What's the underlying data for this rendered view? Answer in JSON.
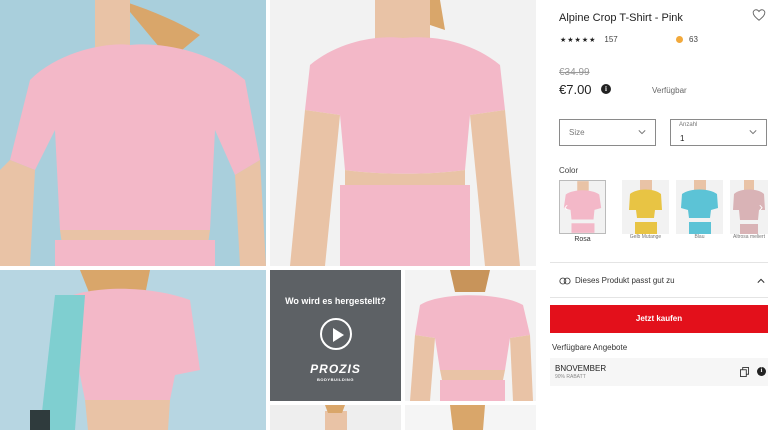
{
  "product": {
    "title": "Alpine Crop T-Shirt - Pink",
    "rating_count": "157",
    "rating_stars": 4.5,
    "points": "63",
    "old_price": "€34.99",
    "price": "€7.00",
    "availability": "Verfügbar"
  },
  "size_select": {
    "placeholder": "Size"
  },
  "quantity_select": {
    "label": "Anzahl",
    "value": "1"
  },
  "color": {
    "label": "Color",
    "options": [
      {
        "label": "Rosa",
        "hex": "#f3b8c8",
        "selected": true
      },
      {
        "label": "Gelb Mutange",
        "hex": "#e8c444"
      },
      {
        "label": "Blau",
        "hex": "#5cc3d6"
      },
      {
        "label": "Altrosa meliert",
        "hex": "#d9b3b6"
      }
    ]
  },
  "fit": {
    "label": "Dieses Produkt passt gut zu"
  },
  "buy_button": {
    "label": "Jetzt kaufen"
  },
  "offers": {
    "title": "Verfügbare Angebote",
    "items": [
      {
        "code": "BNOVEMBER",
        "description": "90% RABATT"
      }
    ]
  },
  "gallery": {
    "video_title": "Wo wird es hergestellt?",
    "brand": "PROZIS",
    "brand_sub": "BODYBUILDING"
  },
  "colors": {
    "accent": "#e3101b",
    "garment": "#f3b8c8",
    "tile_blue": "#a9cfdc"
  },
  "icons": [
    "heart-icon",
    "star-icon",
    "coin-icon",
    "info-icon",
    "chevron-down-icon",
    "chevron-left-icon",
    "chevron-right-icon",
    "link-rings-icon",
    "chevron-up-icon",
    "copy-icon",
    "play-icon"
  ]
}
